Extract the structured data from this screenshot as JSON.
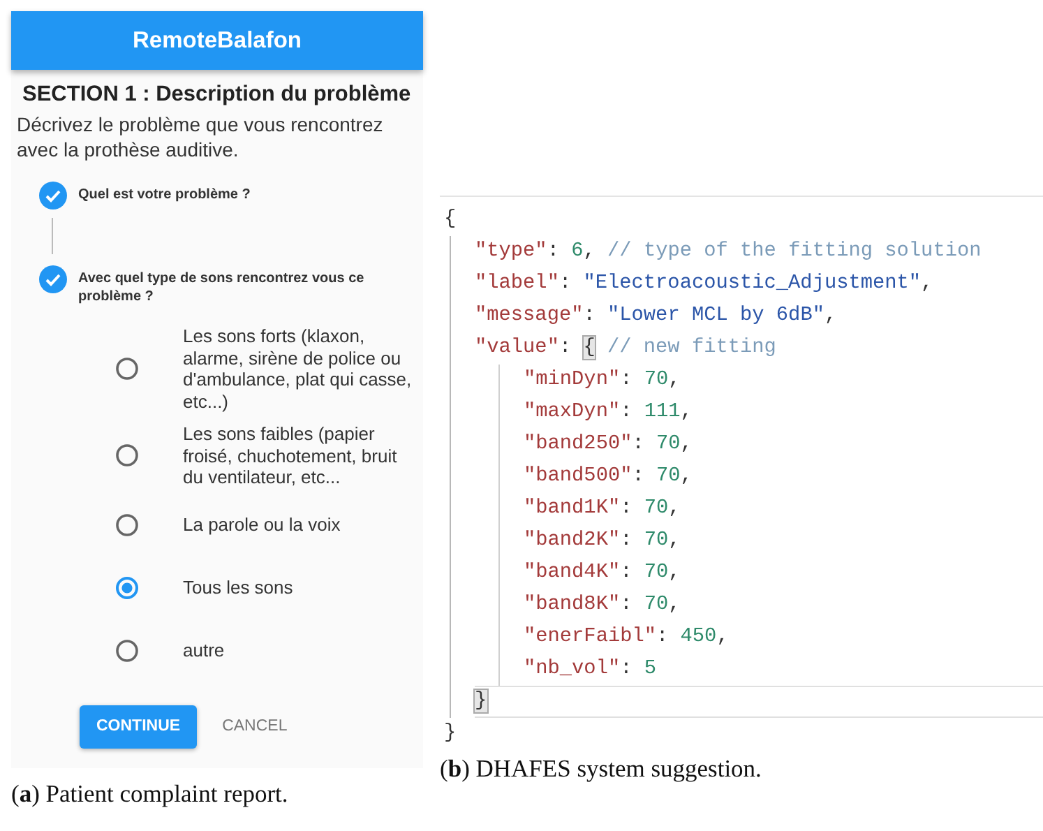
{
  "app": {
    "title": "RemoteBalafon",
    "section_title": "SECTION 1 : Description du problème",
    "description": "Décrivez le problème que vous rencontrez avec la prothèse auditive.",
    "steps": [
      {
        "label": "Quel est votre problème ?",
        "completed": true
      },
      {
        "label": "Avec quel type de sons rencontrez vous ce problème ?",
        "completed": true
      }
    ],
    "options": [
      {
        "label": "Les sons forts (klaxon, alarme, sirène de police ou d'ambulance, plat qui casse, etc...)",
        "selected": false
      },
      {
        "label": "Les sons faibles (papier froisé, chuchotement, bruit du ventilateur, etc...",
        "selected": false
      },
      {
        "label": "La parole ou la voix",
        "selected": false
      },
      {
        "label": "Tous les sons",
        "selected": true
      },
      {
        "label": "autre",
        "selected": false
      }
    ],
    "buttons": [
      {
        "label": "CONTINUE",
        "kind": "primary"
      },
      {
        "label": "CANCEL",
        "kind": "text"
      }
    ]
  },
  "code": {
    "lines": [
      {
        "tokens": [
          {
            "kind": "punct",
            "text": "{"
          }
        ],
        "children": [
          {
            "tokens": [
              {
                "kind": "key",
                "text": "\"type\""
              },
              {
                "kind": "punct",
                "text": ": "
              },
              {
                "kind": "number",
                "text": "6"
              },
              {
                "kind": "punct",
                "text": ", "
              },
              {
                "kind": "comment",
                "text": "// type of the fitting solution"
              }
            ]
          },
          {
            "tokens": [
              {
                "kind": "key",
                "text": "\"label\""
              },
              {
                "kind": "punct",
                "text": ": "
              },
              {
                "kind": "string",
                "text": "\"Electroacoustic_Adjustment\""
              },
              {
                "kind": "punct",
                "text": ","
              }
            ]
          },
          {
            "tokens": [
              {
                "kind": "key",
                "text": "\"message\""
              },
              {
                "kind": "punct",
                "text": ": "
              },
              {
                "kind": "string",
                "text": "\"Lower MCL by 6dB\""
              },
              {
                "kind": "punct",
                "text": ","
              }
            ]
          },
          {
            "tokens": [
              {
                "kind": "key",
                "text": "\"value\""
              },
              {
                "kind": "punct",
                "text": ": "
              },
              {
                "kind": "brace",
                "text": "{",
                "matched": true
              },
              {
                "kind": "comment",
                "text": "// new fitting"
              }
            ],
            "children": [
              {
                "tokens": [
                  {
                    "kind": "key",
                    "text": "\"minDyn\""
                  },
                  {
                    "kind": "punct",
                    "text": ": "
                  },
                  {
                    "kind": "number",
                    "text": "70"
                  },
                  {
                    "kind": "punct",
                    "text": ","
                  }
                ]
              },
              {
                "tokens": [
                  {
                    "kind": "key",
                    "text": "\"maxDyn\""
                  },
                  {
                    "kind": "punct",
                    "text": ": "
                  },
                  {
                    "kind": "number",
                    "text": "111"
                  },
                  {
                    "kind": "punct",
                    "text": ","
                  }
                ]
              },
              {
                "tokens": [
                  {
                    "kind": "key",
                    "text": "\"band250\""
                  },
                  {
                    "kind": "punct",
                    "text": ": "
                  },
                  {
                    "kind": "number",
                    "text": "70"
                  },
                  {
                    "kind": "punct",
                    "text": ","
                  }
                ]
              },
              {
                "tokens": [
                  {
                    "kind": "key",
                    "text": "\"band500\""
                  },
                  {
                    "kind": "punct",
                    "text": ": "
                  },
                  {
                    "kind": "number",
                    "text": "70"
                  },
                  {
                    "kind": "punct",
                    "text": ","
                  }
                ]
              },
              {
                "tokens": [
                  {
                    "kind": "key",
                    "text": "\"band1K\""
                  },
                  {
                    "kind": "punct",
                    "text": ": "
                  },
                  {
                    "kind": "number",
                    "text": "70"
                  },
                  {
                    "kind": "punct",
                    "text": ","
                  }
                ]
              },
              {
                "tokens": [
                  {
                    "kind": "key",
                    "text": "\"band2K\""
                  },
                  {
                    "kind": "punct",
                    "text": ": "
                  },
                  {
                    "kind": "number",
                    "text": "70"
                  },
                  {
                    "kind": "punct",
                    "text": ","
                  }
                ]
              },
              {
                "tokens": [
                  {
                    "kind": "key",
                    "text": "\"band4K\""
                  },
                  {
                    "kind": "punct",
                    "text": ": "
                  },
                  {
                    "kind": "number",
                    "text": "70"
                  },
                  {
                    "kind": "punct",
                    "text": ","
                  }
                ]
              },
              {
                "tokens": [
                  {
                    "kind": "key",
                    "text": "\"band8K\""
                  },
                  {
                    "kind": "punct",
                    "text": ": "
                  },
                  {
                    "kind": "number",
                    "text": "70"
                  },
                  {
                    "kind": "punct",
                    "text": ","
                  }
                ]
              },
              {
                "tokens": [
                  {
                    "kind": "key",
                    "text": "\"enerFaibl\""
                  },
                  {
                    "kind": "punct",
                    "text": ": "
                  },
                  {
                    "kind": "number",
                    "text": "450"
                  },
                  {
                    "kind": "punct",
                    "text": ","
                  }
                ]
              },
              {
                "tokens": [
                  {
                    "kind": "key",
                    "text": "\"nb_vol\""
                  },
                  {
                    "kind": "punct",
                    "text": ": "
                  },
                  {
                    "kind": "number",
                    "text": "5"
                  }
                ]
              }
            ]
          },
          {
            "tokens": [
              {
                "kind": "brace",
                "text": "}",
                "matched": true
              }
            ],
            "current": true
          }
        ]
      },
      {
        "tokens": [
          {
            "kind": "punct",
            "text": "}"
          }
        ]
      }
    ]
  },
  "captions": [
    "(**a**) Patient complaint report.",
    "(**b**) DHAFES system suggestion."
  ]
}
